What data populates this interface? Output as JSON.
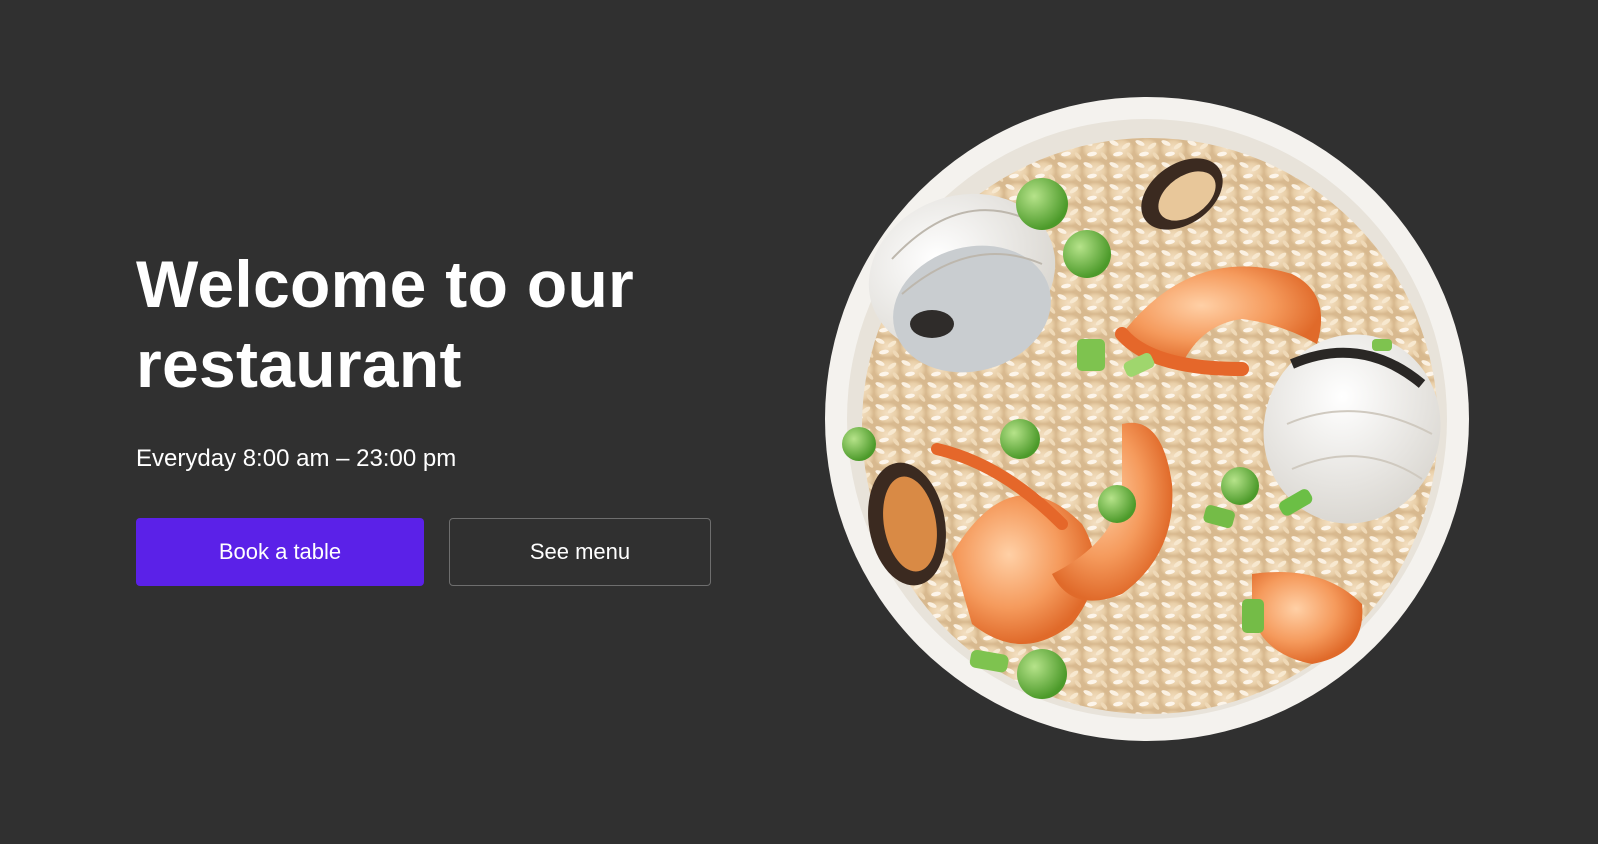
{
  "hero": {
    "title": "Welcome to our restaurant",
    "hours": "Everyday 8:00 am – 23:00 pm",
    "primary_button": "Book a table",
    "secondary_button": "See menu",
    "dish_image": "seafood-fried-rice-bowl"
  },
  "colors": {
    "background": "#303030",
    "accent": "#5b21e8",
    "text": "#ffffff"
  }
}
